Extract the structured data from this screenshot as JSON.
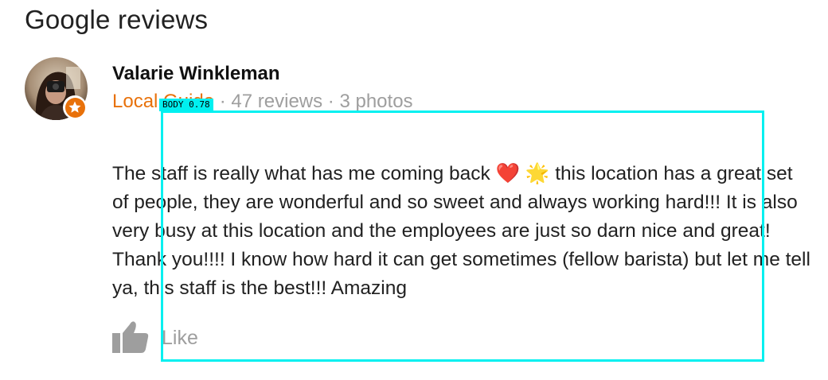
{
  "section": {
    "title": "Google reviews"
  },
  "review": {
    "reviewer_name": "Valarie Winkleman",
    "local_guide_label": "Local Guide",
    "reviews_count": "47 reviews",
    "photos_count": "3 photos",
    "separator": " · ",
    "text_part1": "The staff is really what has me coming back ",
    "emoji_heart": "❤️",
    "emoji_star": "🌟",
    "text_part2": "  this location has a great set of people, they are wonderful and so sweet and always working hard!!! It is also very busy at this location and the employees are just so darn nice and great! Thank you!!!! I know how hard it can get sometimes (fellow barista) but let me tell ya, this staff is the best!!! Amazing",
    "like_label": "Like",
    "icons": {
      "avatar": "avatar-photo",
      "badge": "local-guide-star-icon",
      "like": "thumbs-up-icon"
    }
  },
  "detection_overlay": {
    "label": "BODY 0.78",
    "color": "#00f0f0"
  },
  "colors": {
    "accent_orange": "#e8710a",
    "meta_gray": "#9e9e9e",
    "text_dark": "#212121"
  }
}
